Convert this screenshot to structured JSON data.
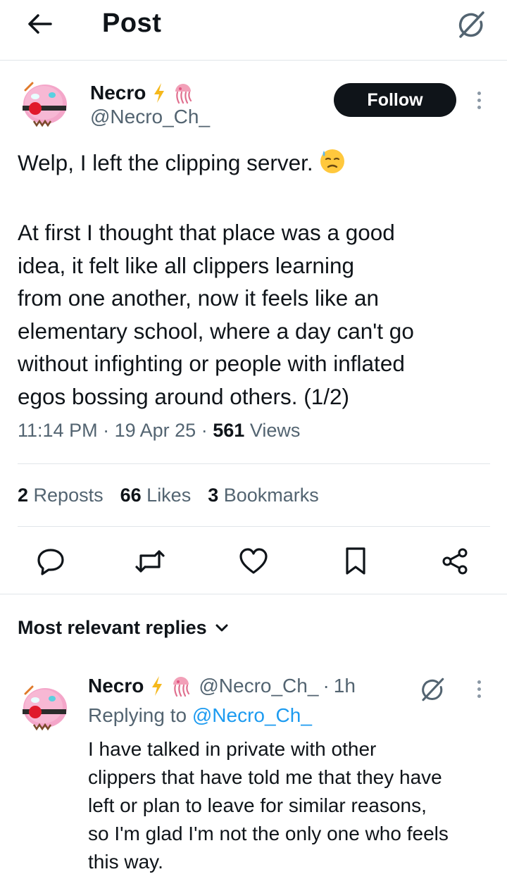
{
  "header": {
    "title": "Post",
    "back_icon": "back-arrow-icon",
    "grok_icon": "grok-icon"
  },
  "post": {
    "author_name": "Necro",
    "badges": [
      "lightning-emoji",
      "jellyfish-emoji"
    ],
    "handle": "@Necro_Ch_",
    "follow_label": "Follow",
    "text_lines": [
      "Welp, I left the clipping server.",
      "",
      "At first I thought that place was a good",
      "idea, it felt like all clippers learning",
      "from one another, now it feels like an",
      "elementary school, where a day can't go",
      "without infighting or people with inflated",
      "egos bossing around others. (1/2)"
    ],
    "emoji": "downcast-sweat-face-emoji",
    "time": "11:14 PM",
    "date": "19 Apr 25",
    "views_count": "561",
    "views_label": "Views",
    "sep": "·"
  },
  "stats": {
    "reposts_count": "2",
    "reposts_label": "Reposts",
    "likes_count": "66",
    "likes_label": "Likes",
    "bookmarks_count": "3",
    "bookmarks_label": "Bookmarks"
  },
  "actions": [
    "reply-icon",
    "repost-icon",
    "like-icon",
    "bookmark-icon",
    "share-icon"
  ],
  "replies": {
    "header": "Most relevant replies",
    "items": [
      {
        "author_name": "Necro",
        "handle": "@Necro_Ch_",
        "time_sep": "·",
        "time": "1h",
        "replying_prefix": "Replying to",
        "replying_to": "@Necro_Ch_",
        "text_lines": [
          "I have talked in private with other",
          "clippers that have told me that they have",
          "left or plan to leave for similar reasons,",
          "so I'm glad I'm not the only one who feels",
          "this way."
        ]
      }
    ]
  },
  "colors": {
    "text": "#0f1419",
    "secondary": "#536471",
    "link": "#1d9bf0",
    "divider": "#e1e5e9",
    "follow_bg": "#0f1419"
  }
}
